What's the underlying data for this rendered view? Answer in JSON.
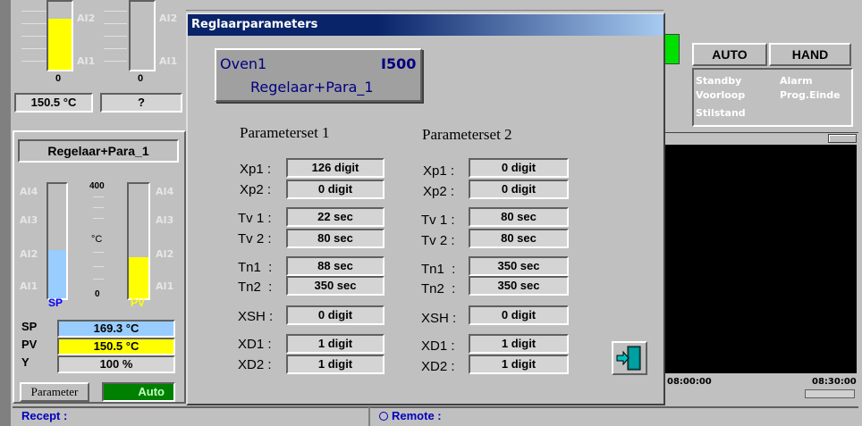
{
  "dialog": {
    "title": "Reglaarparameters",
    "header": {
      "oven": "Oven1",
      "code": "I500",
      "controller": "Regelaar+Para_1"
    },
    "set1": {
      "title": "Parameterset 1",
      "rows": [
        {
          "label": "Xp1 :",
          "value": "126 digit"
        },
        {
          "label": "Xp2 :",
          "value": "0 digit"
        },
        {
          "label": "Tv 1 :",
          "value": "22 sec"
        },
        {
          "label": "Tv 2 :",
          "value": "80 sec"
        },
        {
          "label": "Tn1  :",
          "value": "88 sec"
        },
        {
          "label": "Tn2  :",
          "value": "350 sec"
        },
        {
          "label": "XSH :",
          "value": "0 digit"
        },
        {
          "label": "XD1 :",
          "value": "1 digit"
        },
        {
          "label": "XD2 :",
          "value": "1 digit"
        }
      ]
    },
    "set2": {
      "title": "Parameterset 2",
      "rows": [
        {
          "label": "Xp1 :",
          "value": "0 digit"
        },
        {
          "label": "Xp2 :",
          "value": "0 digit"
        },
        {
          "label": "Tv 1 :",
          "value": "80 sec"
        },
        {
          "label": "Tv 2 :",
          "value": "80 sec"
        },
        {
          "label": "Tn1  :",
          "value": "350 sec"
        },
        {
          "label": "Tn2  :",
          "value": "350 sec"
        },
        {
          "label": "XSH :",
          "value": "0 digit"
        },
        {
          "label": "XD1 :",
          "value": "1 digit"
        },
        {
          "label": "XD2 :",
          "value": "1 digit"
        }
      ]
    }
  },
  "top_left": {
    "gauge1": {
      "ai2": "AI2",
      "ai1": "AI1",
      "zero": "0",
      "value": "150.5 °C",
      "level": 0.75
    },
    "gauge2": {
      "ai2": "AI2",
      "ai1": "AI1",
      "zero": "0",
      "value": "?"
    }
  },
  "controller_panel": {
    "title": "Regelaar+Para_1",
    "ai_labels": [
      "AI4",
      "AI3",
      "AI2",
      "AI1"
    ],
    "scale_top": "400",
    "scale_unit": "°C",
    "scale_zero": "0",
    "sp_bar_label": "SP",
    "pv_bar_label": "PV",
    "sp_level": 0.42,
    "pv_level": 0.36,
    "sp_label": "SP",
    "sp_value": "169.3 °C",
    "pv_label": "PV",
    "pv_value": "150.5 °C",
    "y_label": "Y",
    "y_value": "100 %",
    "parameter_button": "Parameter",
    "auto_status": "Auto"
  },
  "right_panel": {
    "auto_button": "AUTO",
    "hand_button": "HAND",
    "status": [
      "Standby",
      "Alarm",
      "Voorloop",
      "Prog.Einde",
      "Stilstand"
    ],
    "time_start": "08:00:00",
    "time_end": "08:30:00"
  },
  "statusbar": {
    "recept": "Recept :",
    "remote": "Remote :"
  },
  "colors": {
    "title_bar": "#0a246a",
    "sp_blue": "#99ccff",
    "pv_yellow": "#ffff00",
    "auto_green": "#008000",
    "chart_bg": "#000000"
  }
}
